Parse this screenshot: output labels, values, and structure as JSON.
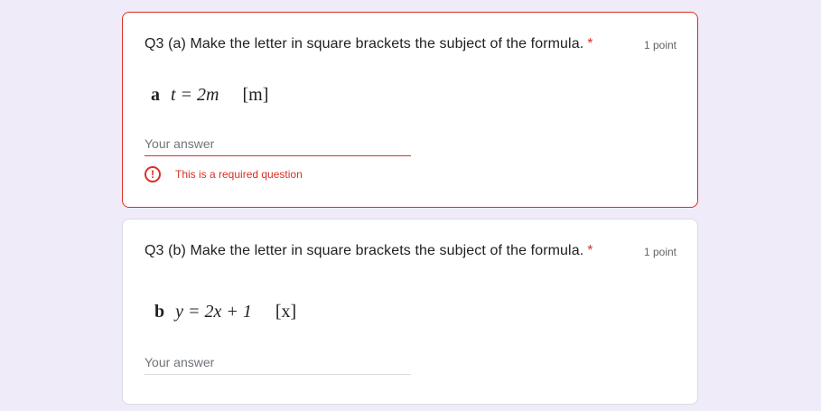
{
  "questions": [
    {
      "title": "Q3 (a) Make the letter in square brackets the subject of the formula.",
      "required_marker": "*",
      "points": "1 point",
      "formula": {
        "label": "a",
        "equation": "t = 2m",
        "bracket": "[m]"
      },
      "answer_placeholder": "Your answer",
      "error": {
        "icon": "error-circle-icon",
        "message": "This is a required question"
      }
    },
    {
      "title": "Q3 (b) Make the letter in square brackets the subject of the formula.",
      "required_marker": "*",
      "points": "1 point",
      "formula": {
        "label": "b",
        "equation": "y = 2x + 1",
        "bracket": "[x]"
      },
      "answer_placeholder": "Your answer"
    }
  ],
  "colors": {
    "error": "#d93025",
    "background": "#f0ebf8"
  }
}
